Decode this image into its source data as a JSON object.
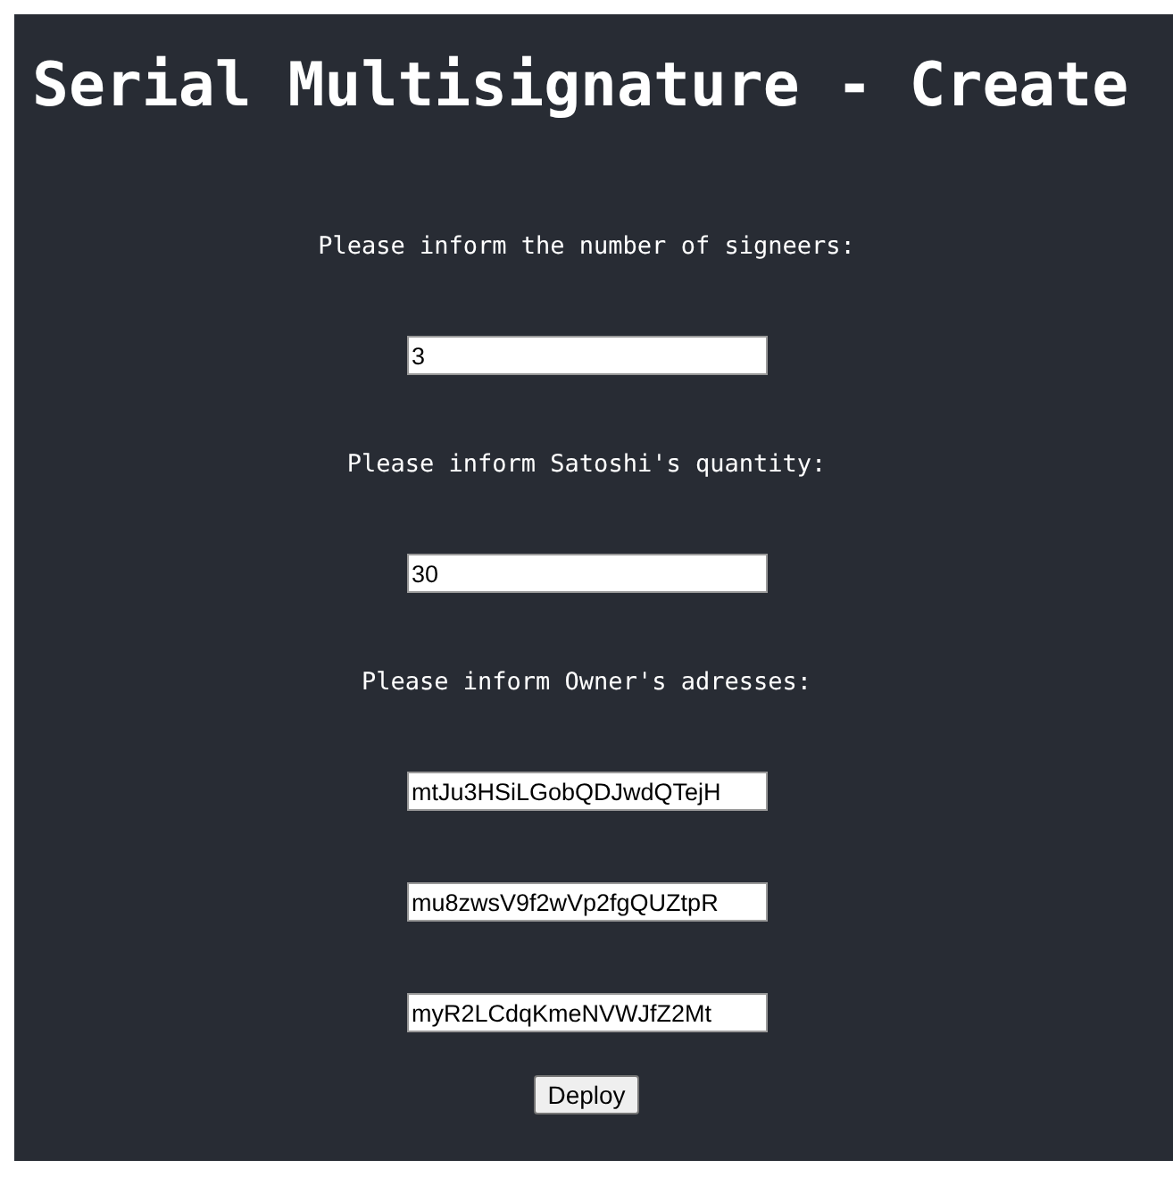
{
  "title": "Serial Multisignature - Create",
  "signers": {
    "label": "Please inform the number of signeers:",
    "value": "3"
  },
  "satoshi": {
    "label": "Please inform Satoshi's quantity:",
    "value": "30"
  },
  "owners": {
    "label": "Please inform Owner's adresses:",
    "addresses": [
      {
        "value": "mtJu3HSiLGobQDJwdQTejH"
      },
      {
        "value": "mu8zwsV9f2wVp2fgQUZtpR"
      },
      {
        "value": "myR2LCdqKmeNVWJfZ2Mt"
      }
    ]
  },
  "button": "Deploy"
}
